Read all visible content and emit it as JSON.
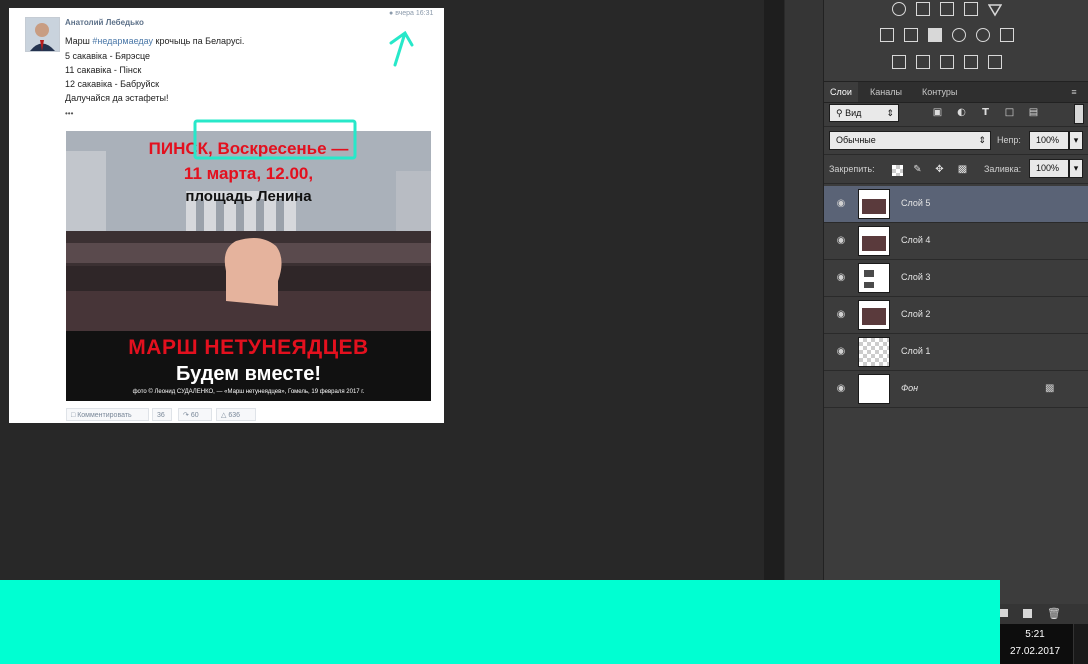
{
  "post": {
    "author": "Анатолий Лебедько",
    "time": "вчера 16:31",
    "line1_prefix": "Марш ",
    "line1_hashtag": "#недармаедау",
    "line1_suffix": " крочыць па Беларусі.",
    "line2": "5 сакавіка - Бярэсце",
    "line3": "11 сакавіка - Пінск",
    "line4": "12 сакавіка - Бабруйск",
    "line5": "Далучайся да эстафеты!",
    "ellipsis": "•••",
    "image": {
      "top_city": "ПИНСК,",
      "top_day": "Воскресенье",
      "dash": "—",
      "date": "11 марта, 12.00,",
      "place": "площадь Ленина",
      "march": "МАРШ НЕТУНЕЯДЦЕВ",
      "together": "Будем вместе!",
      "caption": "фото © Леонид СУДАЛЕНКО, — «Марш нетунеядцев», Гомель, 19 февраля 2017 г."
    },
    "buttons": {
      "comment": "Комментировать",
      "comment_count": "36",
      "share_count": "60",
      "like_count": "636"
    }
  },
  "panel": {
    "tabs": [
      "Слои",
      "Каналы",
      "Контуры"
    ],
    "filter_label": "Вид",
    "blend_mode": "Обычные",
    "opacity_label": "Непр:",
    "opacity_value": "100%",
    "lock_label": "Закрепить:",
    "fill_label": "Заливка:",
    "fill_value": "100%",
    "layers": [
      {
        "name": "Слой 5"
      },
      {
        "name": "Слой 4"
      },
      {
        "name": "Слой 3"
      },
      {
        "name": "Слой 2"
      },
      {
        "name": "Слой 1"
      },
      {
        "name": "Фон"
      }
    ]
  },
  "taskbar": {
    "time": "5:21",
    "date": "27.02.2017"
  },
  "colors": {
    "annotation": "#27e8c9",
    "red_text": "#e3101e",
    "selected_layer": "#5a6376"
  }
}
